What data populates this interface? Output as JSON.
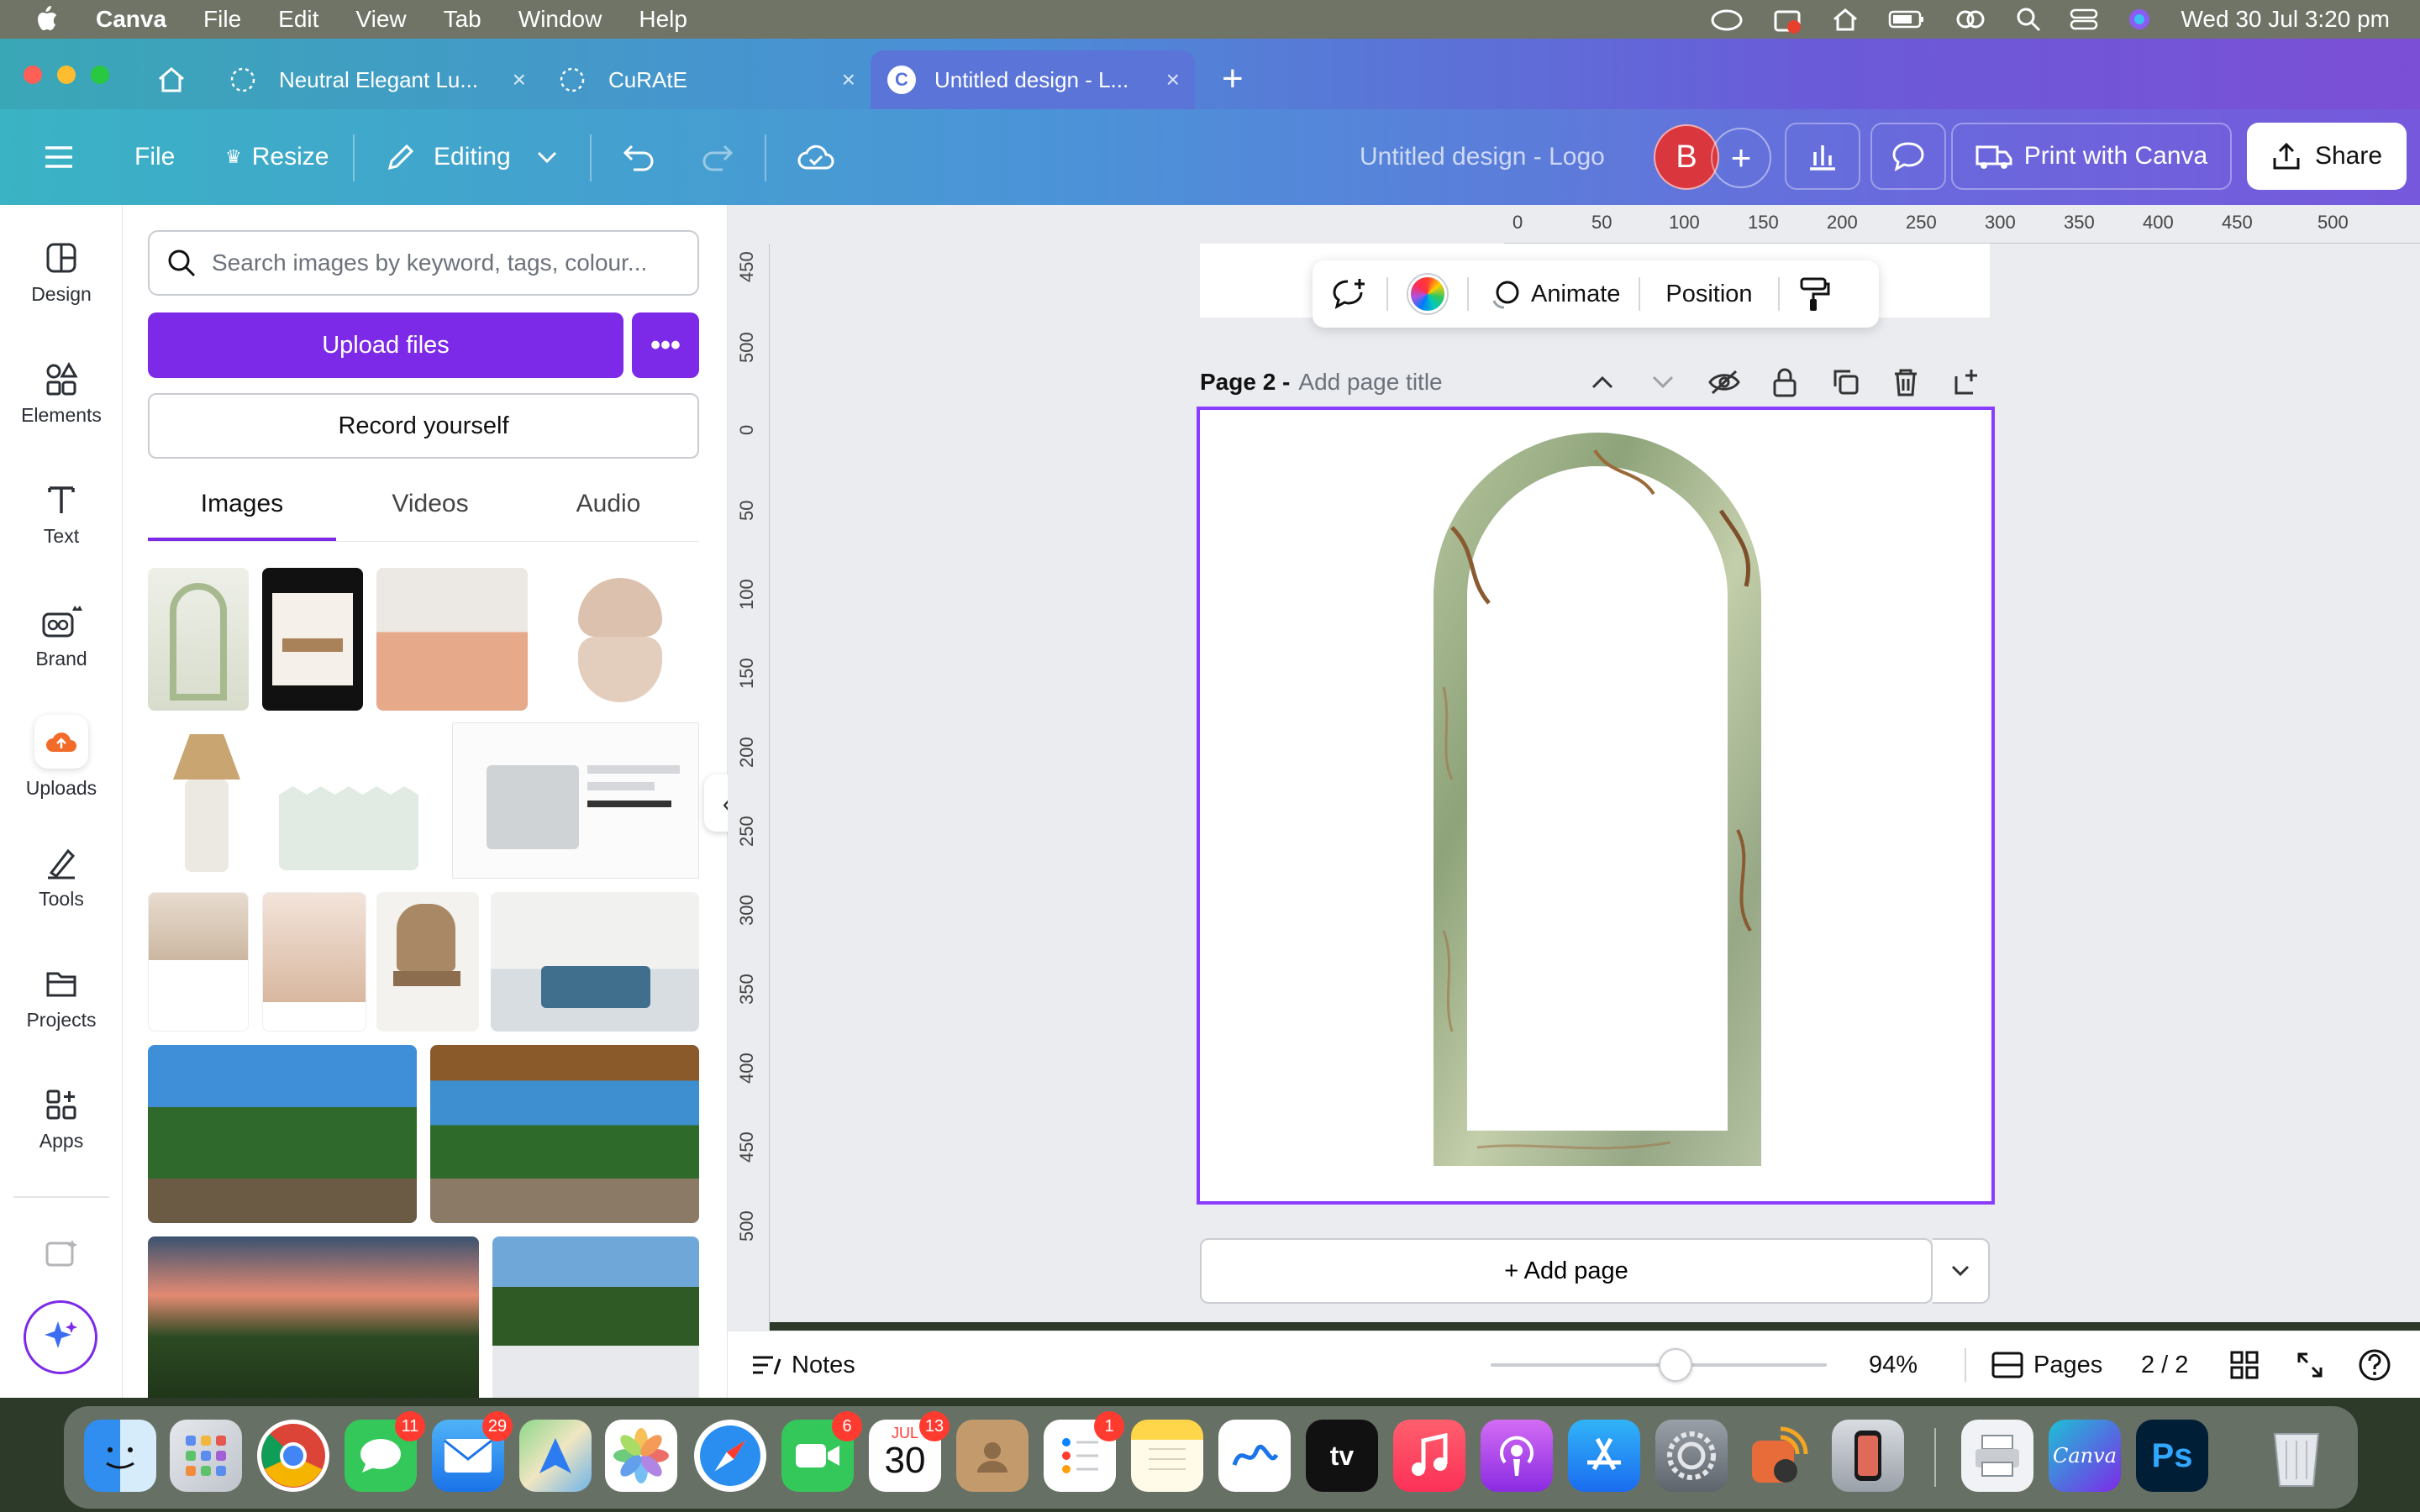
{
  "menubar": {
    "app": "Canva",
    "items": [
      "File",
      "Edit",
      "View",
      "Tab",
      "Window",
      "Help"
    ],
    "clock": "Wed 30 Jul  3:20 pm"
  },
  "browser_tabs": [
    {
      "title": "Neutral Elegant Lu...",
      "active": false
    },
    {
      "title": "CuRAtE",
      "active": false
    },
    {
      "title": "Untitled design - L...",
      "active": true
    }
  ],
  "toolbar": {
    "file": "File",
    "resize": "Resize",
    "editing": "Editing",
    "design_title": "Untitled design - Logo",
    "avatar_initial": "B",
    "print": "Print with Canva",
    "share": "Share"
  },
  "rail": [
    {
      "label": "Design",
      "icon": "design-icon"
    },
    {
      "label": "Elements",
      "icon": "elements-icon"
    },
    {
      "label": "Text",
      "icon": "text-icon"
    },
    {
      "label": "Brand",
      "icon": "brand-icon"
    },
    {
      "label": "Uploads",
      "icon": "uploads-icon"
    },
    {
      "label": "Tools",
      "icon": "tools-icon"
    },
    {
      "label": "Projects",
      "icon": "projects-icon"
    },
    {
      "label": "Apps",
      "icon": "apps-icon"
    }
  ],
  "panel": {
    "search_placeholder": "Search images by keyword, tags, colour...",
    "upload": "Upload files",
    "record": "Record yourself",
    "tabs": [
      "Images",
      "Videos",
      "Audio"
    ]
  },
  "canvas": {
    "ruler_top": [
      "0",
      "50",
      "100",
      "150",
      "200",
      "250",
      "300",
      "350",
      "400",
      "450",
      "500"
    ],
    "ruler_left": [
      "450",
      "500",
      "0",
      "50",
      "100",
      "150",
      "200",
      "250",
      "300",
      "350",
      "400",
      "450",
      "500"
    ],
    "ctx_animate": "Animate",
    "ctx_position": "Position",
    "page_label": "Page 2 -",
    "page_title_placeholder": "Add page title",
    "add_page": "+ Add page"
  },
  "status": {
    "notes": "Notes",
    "zoom": "94%",
    "zoom_fraction": 0.55,
    "pages": "Pages",
    "page_count": "2 / 2"
  },
  "dock": {
    "badges": {
      "messages": "11",
      "mail": "29",
      "facetime": "6",
      "calendar": "13",
      "reminders": "1"
    },
    "calendar_month": "JUL",
    "calendar_day": "30",
    "tv": "tv",
    "canva": "Canva",
    "ps": "Ps"
  },
  "colors": {
    "accent": "#7d2ae8",
    "selection": "#8b3dff",
    "avatar": "#d9363e"
  }
}
